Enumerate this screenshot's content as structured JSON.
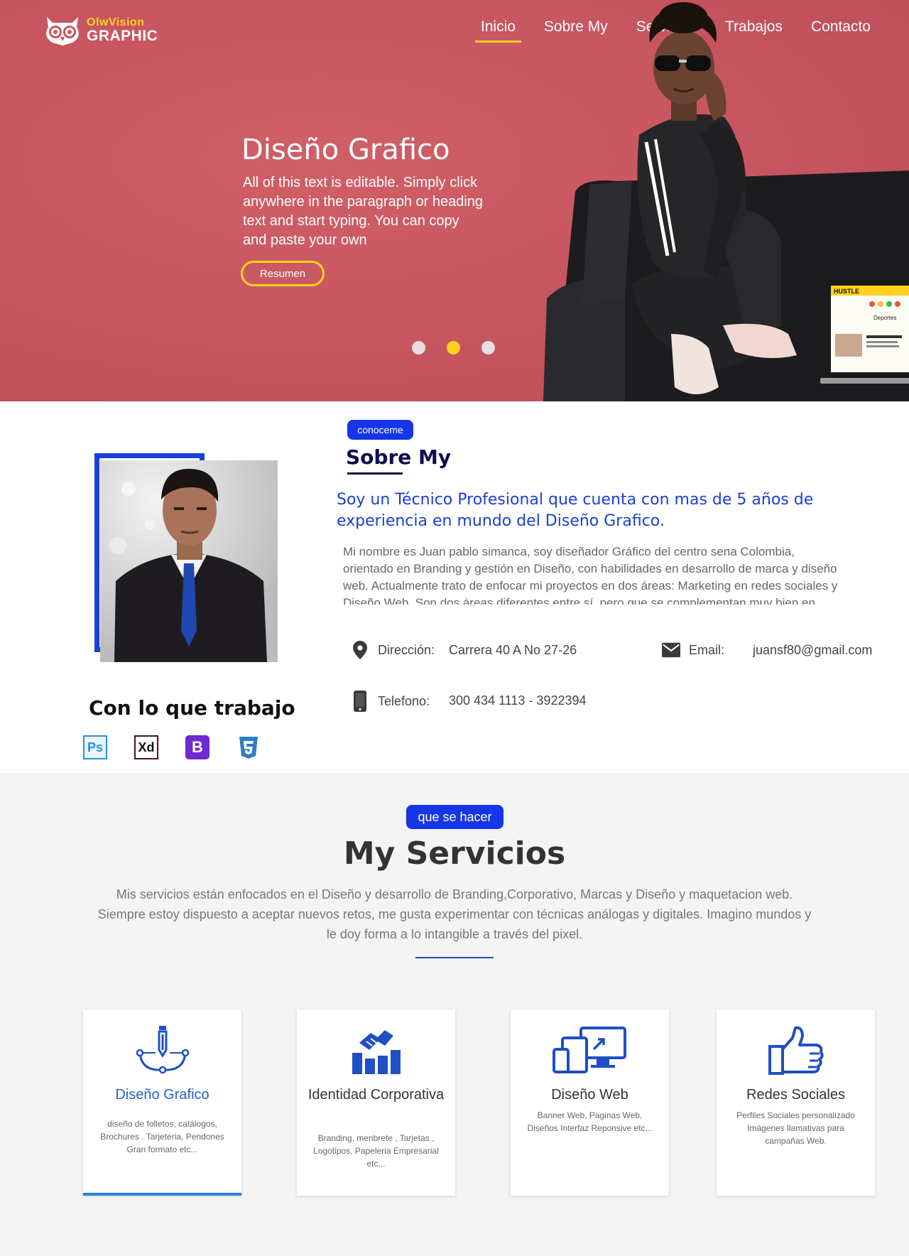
{
  "brand": {
    "line1": "OlwVision",
    "line2": "GRAPHIC"
  },
  "nav": [
    {
      "label": "Inicio",
      "active": true
    },
    {
      "label": "Sobre My"
    },
    {
      "label": "Servicios"
    },
    {
      "label": "Trabajos"
    },
    {
      "label": "Contacto"
    }
  ],
  "hero": {
    "title": "Diseño Grafico",
    "text": "All of this text is editable. Simply click anywhere in the paragraph or heading text and start typing. You can copy and paste your own",
    "button": "Resumen",
    "active_slide": 2,
    "slides": 3,
    "laptop_labels": {
      "brand": "HUSTLE",
      "section": "Deportes"
    }
  },
  "about": {
    "badge": "conoceme",
    "title": "Sobre My",
    "lead": "Soy un Técnico Profesional que cuenta con mas de 5 años de experiencia en mundo del Diseño Grafico.",
    "body": " Mi nombre es Juan pablo simanca, soy diseñador Gráfico del centro sena Colombia, orientado en Branding y gestión en Diseño, con habilidades en desarrollo de marca y diseño web. Actualmente trato de enfocar mi proyectos en dos áreas: Marketing en redes sociales y Diseño Web. Son dos áreas diferentes entre sí, pero que se complementan muy bien en nuestra sociedad global cada",
    "address_label": "Dirección:",
    "address": "Carrera 40 A No 27-26",
    "email_label": "Email:",
    "email": "juansf80@gmail.com",
    "phone_label": "Telefono:",
    "phone": "300 434 1113 - 3922394",
    "tools_title": "Con lo que trabajo",
    "tools": [
      "Ps",
      "Xd",
      "B",
      "CSS3"
    ]
  },
  "services": {
    "badge": "que se hacer",
    "title": "My Servicios",
    "description": "Mis servicios están enfocados en el Diseño y desarrollo de Branding,Corporativo, Marcas y Diseño y maquetacion web. Siempre estoy dispuesto a aceptar nuevos retos, me gusta experimentar con técnicas análogas y digitales. Imagino mundos y le doy forma a lo intangible a través del pixel.",
    "cards": [
      {
        "title": "Diseño Grafico",
        "text": "diseño de folletos, catálogos, Brochures . Tarjeteria, Pendones Gran formato etc...",
        "icon": "pen-tool-icon",
        "active": true
      },
      {
        "title": "Identidad Corporativa",
        "text": "Branding, menbrete , Tarjetas , Logotipos, Papeleria Empresarial etc...",
        "icon": "handshake-chart-icon"
      },
      {
        "title": "Diseño Web",
        "text": "Banner Web, Paginas Web, Diseños Interfaz Reponsive etc...",
        "icon": "devices-icon"
      },
      {
        "title": "Redes Sociales",
        "text": "Perfiles Sociales personalizado Imágenes llamativas para campañas Web.",
        "icon": "thumbs-up-icon"
      }
    ]
  },
  "colors": {
    "hero_bg": "#c75560",
    "accent_yellow": "#ffd21f",
    "primary_blue": "#1635e8",
    "heading_navy": "#0a0f4d",
    "services_bg": "#f4f4f4"
  }
}
